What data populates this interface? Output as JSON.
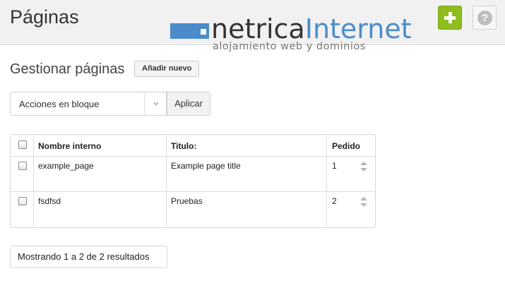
{
  "header": {
    "title": "Páginas",
    "logo_name_a": "netrica",
    "logo_name_b": "Internet",
    "logo_tagline": "alojamiento web y dominios",
    "add_icon": "plus-icon",
    "help_icon": "question-icon",
    "help_symbol": "?",
    "accent_color": "#8fbc1e",
    "brand_color": "#4a8ccb"
  },
  "section": {
    "title": "Gestionar páginas",
    "add_new_label": "Añadir nuevo"
  },
  "bulk": {
    "selected": "Acciones en bloque",
    "apply_label": "Aplicar"
  },
  "table": {
    "columns": [
      "Nombre interno",
      "Titulo:",
      "Pedido"
    ],
    "rows": [
      {
        "name": "example_page",
        "title": "Example page title",
        "order": "1"
      },
      {
        "name": "fsdfsd",
        "title": "Pruebas",
        "order": "2"
      }
    ]
  },
  "footer": {
    "results_text": "Mostrando 1 a 2 de 2 resultados"
  }
}
